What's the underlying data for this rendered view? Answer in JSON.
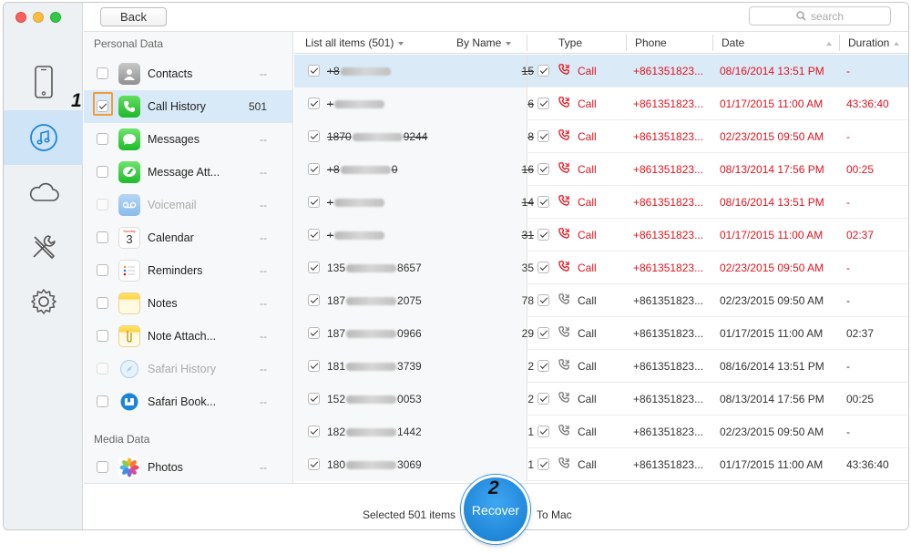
{
  "toolbar": {
    "back_label": "Back",
    "search_placeholder": "search"
  },
  "sidebar": {
    "personal_header": "Personal Data",
    "media_header": "Media Data",
    "items": [
      {
        "label": "Contacts",
        "count": "--",
        "icon": "contacts-icon",
        "checked": false,
        "disabled": false
      },
      {
        "label": "Call History",
        "count": "501",
        "icon": "phone-icon",
        "checked": true,
        "disabled": false,
        "active": true
      },
      {
        "label": "Messages",
        "count": "--",
        "icon": "messages-icon",
        "checked": false,
        "disabled": false
      },
      {
        "label": "Message Att...",
        "count": "--",
        "icon": "message-attachment-icon",
        "checked": false,
        "disabled": false
      },
      {
        "label": "Voicemail",
        "count": "--",
        "icon": "voicemail-icon",
        "checked": false,
        "disabled": true
      },
      {
        "label": "Calendar",
        "count": "--",
        "icon": "calendar-icon",
        "checked": false,
        "disabled": false
      },
      {
        "label": "Reminders",
        "count": "--",
        "icon": "reminders-icon",
        "checked": false,
        "disabled": false
      },
      {
        "label": "Notes",
        "count": "--",
        "icon": "notes-icon",
        "checked": false,
        "disabled": false
      },
      {
        "label": "Note Attach...",
        "count": "--",
        "icon": "note-attachment-icon",
        "checked": false,
        "disabled": false
      },
      {
        "label": "Safari History",
        "count": "--",
        "icon": "safari-icon",
        "checked": false,
        "disabled": true
      },
      {
        "label": "Safari Book...",
        "count": "--",
        "icon": "safari-bookmark-icon",
        "checked": false,
        "disabled": false
      }
    ],
    "media_items": [
      {
        "label": "Photos",
        "count": "--",
        "icon": "photos-icon",
        "checked": false
      }
    ],
    "calendar_day": "3",
    "calendar_weekday": "Sunday"
  },
  "table": {
    "headers": {
      "list_all": "List all items (501)",
      "by_name": "By Name",
      "type": "Type",
      "phone": "Phone",
      "date": "Date",
      "duration": "Duration"
    },
    "rows": [
      {
        "prefix": "+8",
        "suffix": "",
        "count": "15",
        "deleted": true,
        "type": "Call",
        "phone": "+861351823...",
        "date": "08/16/2014 13:51 PM",
        "duration": "-",
        "selected": true
      },
      {
        "prefix": "+",
        "suffix": "",
        "count": "6",
        "deleted": true,
        "type": "Call",
        "phone": "+861351823...",
        "date": "01/17/2015 11:00 AM",
        "duration": "43:36:40",
        "selected": false
      },
      {
        "prefix": "1870",
        "suffix": "9244",
        "count": "8",
        "deleted": true,
        "type": "Call",
        "phone": "+861351823...",
        "date": "02/23/2015 09:50 AM",
        "duration": "-",
        "selected": false
      },
      {
        "prefix": "+8",
        "suffix": "0",
        "count": "16",
        "deleted": true,
        "type": "Call",
        "phone": "+861351823...",
        "date": "08/13/2014 17:56 PM",
        "duration": "00:25",
        "selected": false
      },
      {
        "prefix": "+",
        "suffix": "",
        "count": "14",
        "deleted": true,
        "type": "Call",
        "phone": "+861351823...",
        "date": "08/16/2014 13:51 PM",
        "duration": "-",
        "selected": false
      },
      {
        "prefix": "+",
        "suffix": "",
        "count": "31",
        "deleted": true,
        "type": "Call",
        "phone": "+861351823...",
        "date": "01/17/2015 11:00 AM",
        "duration": "02:37",
        "selected": false
      },
      {
        "prefix": "135",
        "suffix": "8657",
        "count": "35",
        "deleted": false,
        "red": true,
        "type": "Call",
        "phone": "+861351823...",
        "date": "02/23/2015 09:50 AM",
        "duration": "-",
        "selected": false
      },
      {
        "prefix": "187",
        "suffix": "2075",
        "count": "78",
        "deleted": false,
        "red": false,
        "type": "Call",
        "phone": "+861351823...",
        "date": "02/23/2015 09:50 AM",
        "duration": "-",
        "selected": false
      },
      {
        "prefix": "187",
        "suffix": "0966",
        "count": "29",
        "deleted": false,
        "red": false,
        "type": "Call",
        "phone": "+861351823...",
        "date": "01/17/2015 11:00 AM",
        "duration": "02:37",
        "selected": false
      },
      {
        "prefix": "181",
        "suffix": "3739",
        "count": "2",
        "deleted": false,
        "red": false,
        "type": "Call",
        "phone": "+861351823...",
        "date": "08/16/2014 13:51 PM",
        "duration": "-",
        "selected": false
      },
      {
        "prefix": "152",
        "suffix": "0053",
        "count": "2",
        "deleted": false,
        "red": false,
        "type": "Call",
        "phone": "+861351823...",
        "date": "08/13/2014 17:56 PM",
        "duration": "00:25",
        "selected": false
      },
      {
        "prefix": "182",
        "suffix": "1442",
        "count": "1",
        "deleted": false,
        "red": false,
        "type": "Call",
        "phone": "+861351823...",
        "date": "02/23/2015 09:50 AM",
        "duration": "-",
        "selected": false
      },
      {
        "prefix": "180",
        "suffix": "3069",
        "count": "1",
        "deleted": false,
        "red": false,
        "type": "Call",
        "phone": "+861351823...",
        "date": "01/17/2015 11:00 AM",
        "duration": "43:36:40",
        "selected": false
      }
    ]
  },
  "bottom": {
    "selected_text": "Selected 501 items",
    "recover_label": "Recover",
    "to_mac": "To Mac"
  },
  "annotations": {
    "step1": "1",
    "step2": "2"
  },
  "colors": {
    "accent": "#1b86d8",
    "deleted_red": "#e0141e",
    "highlight": "#f39a3a"
  }
}
